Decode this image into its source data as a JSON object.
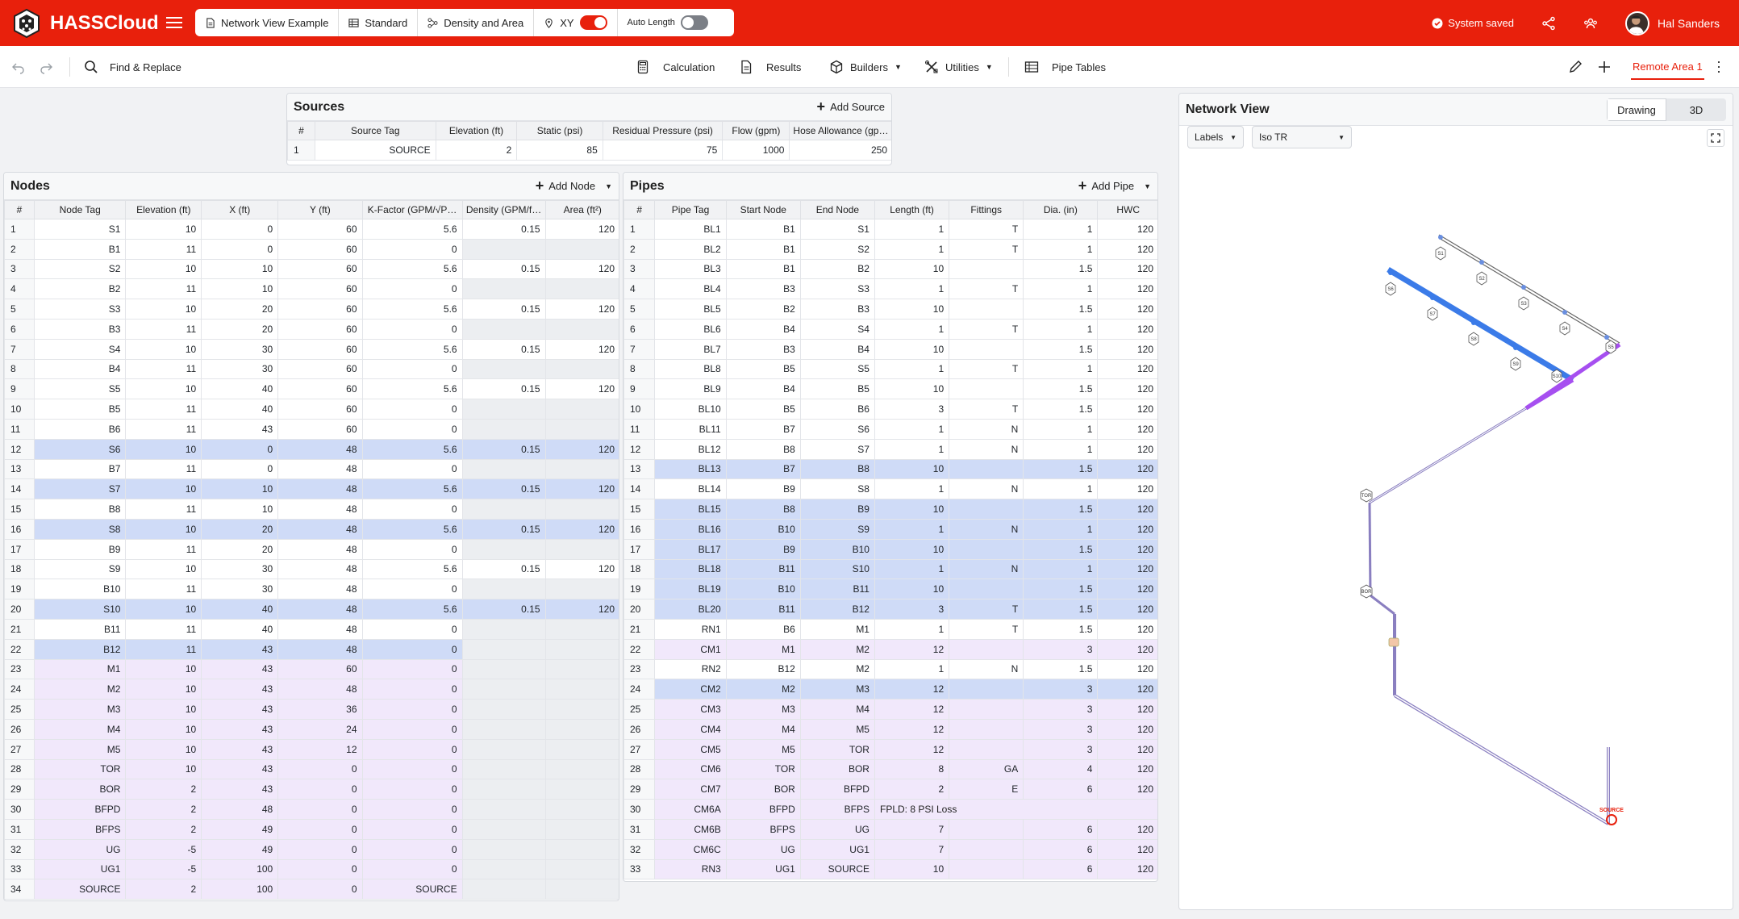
{
  "app": {
    "name": "HASSCloud"
  },
  "toolbar": {
    "project": "Network View Example",
    "standard": "Standard",
    "mode": "Density and Area",
    "xy_label": "XY",
    "auto_length_label": "Auto Length",
    "status": "System saved",
    "user": "Hal Sanders"
  },
  "toolbar2": {
    "find_replace": "Find & Replace",
    "calculation": "Calculation",
    "results": "Results",
    "builders": "Builders",
    "utilities": "Utilities",
    "pipe_tables": "Pipe Tables",
    "remote_area": "Remote Area 1"
  },
  "sources": {
    "title": "Sources",
    "add_label": "Add Source",
    "columns": [
      "#",
      "Source Tag",
      "Elevation (ft)",
      "Static (psi)",
      "Residual Pressure (psi)",
      "Flow (gpm)",
      "Hose Allowance (gpm)"
    ],
    "rows": [
      [
        "1",
        "SOURCE",
        "2",
        "85",
        "75",
        "1000",
        "250"
      ]
    ]
  },
  "nodes": {
    "title": "Nodes",
    "add_label": "Add Node",
    "columns": [
      "#",
      "Node Tag",
      "Elevation (ft)",
      "X (ft)",
      "Y (ft)",
      "K-Factor (GPM/√P…",
      "Density (GPM/f…",
      "Area (ft²)"
    ],
    "rows": [
      {
        "c": [
          "1",
          "S1",
          "10",
          "0",
          "60",
          "5.6",
          "0.15",
          "120"
        ],
        "s": ""
      },
      {
        "c": [
          "2",
          "B1",
          "11",
          "0",
          "60",
          "0",
          "",
          ""
        ],
        "s": ""
      },
      {
        "c": [
          "3",
          "S2",
          "10",
          "10",
          "60",
          "5.6",
          "0.15",
          "120"
        ],
        "s": ""
      },
      {
        "c": [
          "4",
          "B2",
          "11",
          "10",
          "60",
          "0",
          "",
          ""
        ],
        "s": ""
      },
      {
        "c": [
          "5",
          "S3",
          "10",
          "20",
          "60",
          "5.6",
          "0.15",
          "120"
        ],
        "s": ""
      },
      {
        "c": [
          "6",
          "B3",
          "11",
          "20",
          "60",
          "0",
          "",
          ""
        ],
        "s": ""
      },
      {
        "c": [
          "7",
          "S4",
          "10",
          "30",
          "60",
          "5.6",
          "0.15",
          "120"
        ],
        "s": ""
      },
      {
        "c": [
          "8",
          "B4",
          "11",
          "30",
          "60",
          "0",
          "",
          ""
        ],
        "s": ""
      },
      {
        "c": [
          "9",
          "S5",
          "10",
          "40",
          "60",
          "5.6",
          "0.15",
          "120"
        ],
        "s": ""
      },
      {
        "c": [
          "10",
          "B5",
          "11",
          "40",
          "60",
          "0",
          "",
          ""
        ],
        "s": ""
      },
      {
        "c": [
          "11",
          "B6",
          "11",
          "43",
          "60",
          "0",
          "",
          ""
        ],
        "s": ""
      },
      {
        "c": [
          "12",
          "S6",
          "10",
          "0",
          "48",
          "5.6",
          "0.15",
          "120"
        ],
        "s": "sel"
      },
      {
        "c": [
          "13",
          "B7",
          "11",
          "0",
          "48",
          "0",
          "",
          ""
        ],
        "s": ""
      },
      {
        "c": [
          "14",
          "S7",
          "10",
          "10",
          "48",
          "5.6",
          "0.15",
          "120"
        ],
        "s": "sel"
      },
      {
        "c": [
          "15",
          "B8",
          "11",
          "10",
          "48",
          "0",
          "",
          ""
        ],
        "s": ""
      },
      {
        "c": [
          "16",
          "S8",
          "10",
          "20",
          "48",
          "5.6",
          "0.15",
          "120"
        ],
        "s": "sel"
      },
      {
        "c": [
          "17",
          "B9",
          "11",
          "20",
          "48",
          "0",
          "",
          ""
        ],
        "s": ""
      },
      {
        "c": [
          "18",
          "S9",
          "10",
          "30",
          "48",
          "5.6",
          "0.15",
          "120"
        ],
        "s": ""
      },
      {
        "c": [
          "19",
          "B10",
          "11",
          "30",
          "48",
          "0",
          "",
          ""
        ],
        "s": ""
      },
      {
        "c": [
          "20",
          "S10",
          "10",
          "40",
          "48",
          "5.6",
          "0.15",
          "120"
        ],
        "s": "sel"
      },
      {
        "c": [
          "21",
          "B11",
          "11",
          "40",
          "48",
          "0",
          "",
          ""
        ],
        "s": ""
      },
      {
        "c": [
          "22",
          "B12",
          "11",
          "43",
          "48",
          "0",
          "",
          ""
        ],
        "s": "sel"
      },
      {
        "c": [
          "23",
          "M1",
          "10",
          "43",
          "60",
          "0",
          "",
          ""
        ],
        "s": "main"
      },
      {
        "c": [
          "24",
          "M2",
          "10",
          "43",
          "48",
          "0",
          "",
          ""
        ],
        "s": "main"
      },
      {
        "c": [
          "25",
          "M3",
          "10",
          "43",
          "36",
          "0",
          "",
          ""
        ],
        "s": "main"
      },
      {
        "c": [
          "26",
          "M4",
          "10",
          "43",
          "24",
          "0",
          "",
          ""
        ],
        "s": "main"
      },
      {
        "c": [
          "27",
          "M5",
          "10",
          "43",
          "12",
          "0",
          "",
          ""
        ],
        "s": "main"
      },
      {
        "c": [
          "28",
          "TOR",
          "10",
          "43",
          "0",
          "0",
          "",
          ""
        ],
        "s": "main"
      },
      {
        "c": [
          "29",
          "BOR",
          "2",
          "43",
          "0",
          "0",
          "",
          ""
        ],
        "s": "main"
      },
      {
        "c": [
          "30",
          "BFPD",
          "2",
          "48",
          "0",
          "0",
          "",
          ""
        ],
        "s": "main"
      },
      {
        "c": [
          "31",
          "BFPS",
          "2",
          "49",
          "0",
          "0",
          "",
          ""
        ],
        "s": "main"
      },
      {
        "c": [
          "32",
          "UG",
          "-5",
          "49",
          "0",
          "0",
          "",
          ""
        ],
        "s": "main"
      },
      {
        "c": [
          "33",
          "UG1",
          "-5",
          "100",
          "0",
          "0",
          "",
          ""
        ],
        "s": "main"
      },
      {
        "c": [
          "34",
          "SOURCE",
          "2",
          "100",
          "0",
          "SOURCE",
          "",
          ""
        ],
        "s": "main"
      }
    ]
  },
  "pipes": {
    "title": "Pipes",
    "add_label": "Add Pipe",
    "columns": [
      "#",
      "Pipe Tag",
      "Start Node",
      "End Node",
      "Length (ft)",
      "Fittings",
      "Dia. (in)",
      "HWC"
    ],
    "rows": [
      {
        "c": [
          "1",
          "BL1",
          "B1",
          "S1",
          "1",
          "T",
          "1",
          "120"
        ],
        "s": ""
      },
      {
        "c": [
          "2",
          "BL2",
          "B1",
          "S2",
          "1",
          "T",
          "1",
          "120"
        ],
        "s": ""
      },
      {
        "c": [
          "3",
          "BL3",
          "B1",
          "B2",
          "10",
          "",
          "1.5",
          "120"
        ],
        "s": ""
      },
      {
        "c": [
          "4",
          "BL4",
          "B3",
          "S3",
          "1",
          "T",
          "1",
          "120"
        ],
        "s": ""
      },
      {
        "c": [
          "5",
          "BL5",
          "B2",
          "B3",
          "10",
          "",
          "1.5",
          "120"
        ],
        "s": ""
      },
      {
        "c": [
          "6",
          "BL6",
          "B4",
          "S4",
          "1",
          "T",
          "1",
          "120"
        ],
        "s": ""
      },
      {
        "c": [
          "7",
          "BL7",
          "B3",
          "B4",
          "10",
          "",
          "1.5",
          "120"
        ],
        "s": ""
      },
      {
        "c": [
          "8",
          "BL8",
          "B5",
          "S5",
          "1",
          "T",
          "1",
          "120"
        ],
        "s": ""
      },
      {
        "c": [
          "9",
          "BL9",
          "B4",
          "B5",
          "10",
          "",
          "1.5",
          "120"
        ],
        "s": ""
      },
      {
        "c": [
          "10",
          "BL10",
          "B5",
          "B6",
          "3",
          "T",
          "1.5",
          "120"
        ],
        "s": ""
      },
      {
        "c": [
          "11",
          "BL11",
          "B7",
          "S6",
          "1",
          "N",
          "1",
          "120"
        ],
        "s": ""
      },
      {
        "c": [
          "12",
          "BL12",
          "B8",
          "S7",
          "1",
          "N",
          "1",
          "120"
        ],
        "s": ""
      },
      {
        "c": [
          "13",
          "BL13",
          "B7",
          "B8",
          "10",
          "",
          "1.5",
          "120"
        ],
        "s": "sel"
      },
      {
        "c": [
          "14",
          "BL14",
          "B9",
          "S8",
          "1",
          "N",
          "1",
          "120"
        ],
        "s": ""
      },
      {
        "c": [
          "15",
          "BL15",
          "B8",
          "B9",
          "10",
          "",
          "1.5",
          "120"
        ],
        "s": "sel"
      },
      {
        "c": [
          "16",
          "BL16",
          "B10",
          "S9",
          "1",
          "N",
          "1",
          "120"
        ],
        "s": "sel"
      },
      {
        "c": [
          "17",
          "BL17",
          "B9",
          "B10",
          "10",
          "",
          "1.5",
          "120"
        ],
        "s": "sel"
      },
      {
        "c": [
          "18",
          "BL18",
          "B11",
          "S10",
          "1",
          "N",
          "1",
          "120"
        ],
        "s": "sel"
      },
      {
        "c": [
          "19",
          "BL19",
          "B10",
          "B11",
          "10",
          "",
          "1.5",
          "120"
        ],
        "s": "sel"
      },
      {
        "c": [
          "20",
          "BL20",
          "B11",
          "B12",
          "3",
          "T",
          "1.5",
          "120"
        ],
        "s": "sel"
      },
      {
        "c": [
          "21",
          "RN1",
          "B6",
          "M1",
          "1",
          "T",
          "1.5",
          "120"
        ],
        "s": ""
      },
      {
        "c": [
          "22",
          "CM1",
          "M1",
          "M2",
          "12",
          "",
          "3",
          "120"
        ],
        "s": "main"
      },
      {
        "c": [
          "23",
          "RN2",
          "B12",
          "M2",
          "1",
          "N",
          "1.5",
          "120"
        ],
        "s": ""
      },
      {
        "c": [
          "24",
          "CM2",
          "M2",
          "M3",
          "12",
          "",
          "3",
          "120"
        ],
        "s": "sel"
      },
      {
        "c": [
          "25",
          "CM3",
          "M3",
          "M4",
          "12",
          "",
          "3",
          "120"
        ],
        "s": "main"
      },
      {
        "c": [
          "26",
          "CM4",
          "M4",
          "M5",
          "12",
          "",
          "3",
          "120"
        ],
        "s": "main"
      },
      {
        "c": [
          "27",
          "CM5",
          "M5",
          "TOR",
          "12",
          "",
          "3",
          "120"
        ],
        "s": "main"
      },
      {
        "c": [
          "28",
          "CM6",
          "TOR",
          "BOR",
          "8",
          "GA",
          "4",
          "120"
        ],
        "s": "main"
      },
      {
        "c": [
          "29",
          "CM7",
          "BOR",
          "BFPD",
          "2",
          "E",
          "6",
          "120"
        ],
        "s": "main"
      },
      {
        "c": [
          "30",
          "CM6A",
          "BFPD",
          "BFPS"
        ],
        "note": "FPLD: 8 PSI Loss",
        "s": "main"
      },
      {
        "c": [
          "31",
          "CM6B",
          "BFPS",
          "UG",
          "7",
          "",
          "6",
          "120"
        ],
        "s": "main"
      },
      {
        "c": [
          "32",
          "CM6C",
          "UG",
          "UG1",
          "7",
          "",
          "6",
          "120"
        ],
        "s": "main"
      },
      {
        "c": [
          "33",
          "RN3",
          "UG1",
          "SOURCE",
          "10",
          "",
          "6",
          "120"
        ],
        "s": "main"
      }
    ]
  },
  "network_view": {
    "title": "Network View",
    "tabs": [
      "Drawing",
      "3D"
    ],
    "active_tab": "Drawing",
    "labels_dropdown": "Labels",
    "view_dropdown": "Iso TR",
    "sprinkler_labels_top": [
      "S1",
      "S2",
      "S3",
      "S4",
      "S5"
    ],
    "sprinkler_labels_bottom": [
      "S6",
      "S7",
      "S8",
      "S9",
      "S10"
    ],
    "riser_labels": [
      "TOR",
      "BOR"
    ],
    "source_label": "SOURCE",
    "colors": {
      "selected_branch": "#3b7be8",
      "highlight": "#a64ff0",
      "pipe": "#8a7fc0",
      "brand": "#e8200c"
    }
  }
}
